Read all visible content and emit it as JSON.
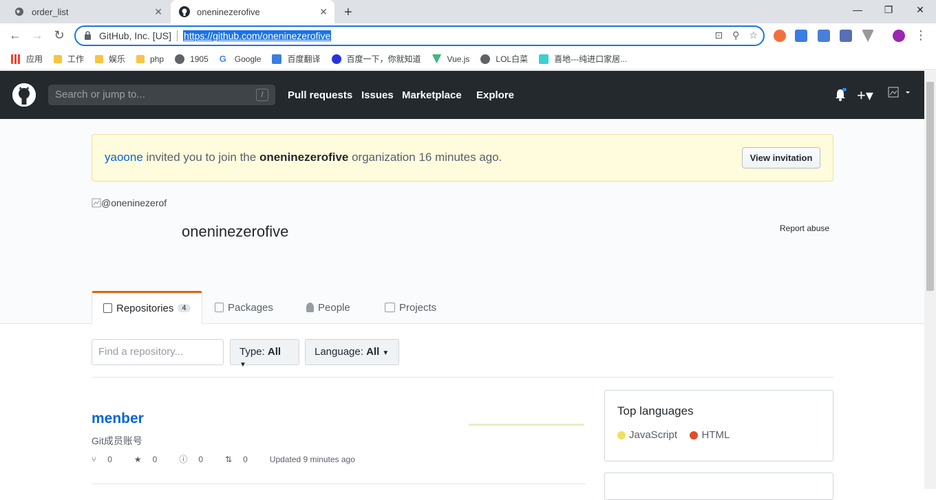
{
  "browser": {
    "tabs": [
      {
        "title": "order_list",
        "active": false
      },
      {
        "title": "oneninezerofive",
        "active": true
      }
    ],
    "omnibox": {
      "company": "GitHub, Inc. [US]",
      "url": "https://github.com/oneninezerofive"
    },
    "bookmarks": [
      "应用",
      "工作",
      "娱乐",
      "php",
      "1905",
      "Google",
      "百度翻译",
      "百度一下，你就知道",
      "Vue.js",
      "LOL白菜",
      "喜地---纯进口家居..."
    ]
  },
  "github": {
    "search_placeholder": "Search or jump to...",
    "search_key": "/",
    "nav": [
      "Pull requests",
      "Issues",
      "Marketplace",
      "Explore"
    ]
  },
  "flash": {
    "inviter": "yaoone",
    "text1": " invited you to join the ",
    "org": "oneninezerofive",
    "text2": " organization 16 minutes ago.",
    "button": "View invitation"
  },
  "org": {
    "avatar_alt": "@oneninezerofive",
    "name": "oneninezerofive",
    "report": "Report abuse"
  },
  "org_tabs": [
    {
      "label": "Repositories",
      "count": "4"
    },
    {
      "label": "Packages"
    },
    {
      "label": "People"
    },
    {
      "label": "Projects"
    }
  ],
  "filters": {
    "find_placeholder": "Find a repository...",
    "type_label": "Type:",
    "type_value": "All",
    "lang_label": "Language:",
    "lang_value": "All"
  },
  "repo": {
    "name": "menber",
    "description": "Git成员账号",
    "forks": "0",
    "stars": "0",
    "issues": "0",
    "prs": "0",
    "updated": "Updated 9 minutes ago"
  },
  "top_languages": {
    "title": "Top languages",
    "items": [
      {
        "name": "JavaScript",
        "color": "#f1e05a"
      },
      {
        "name": "HTML",
        "color": "#e34c26"
      }
    ]
  }
}
